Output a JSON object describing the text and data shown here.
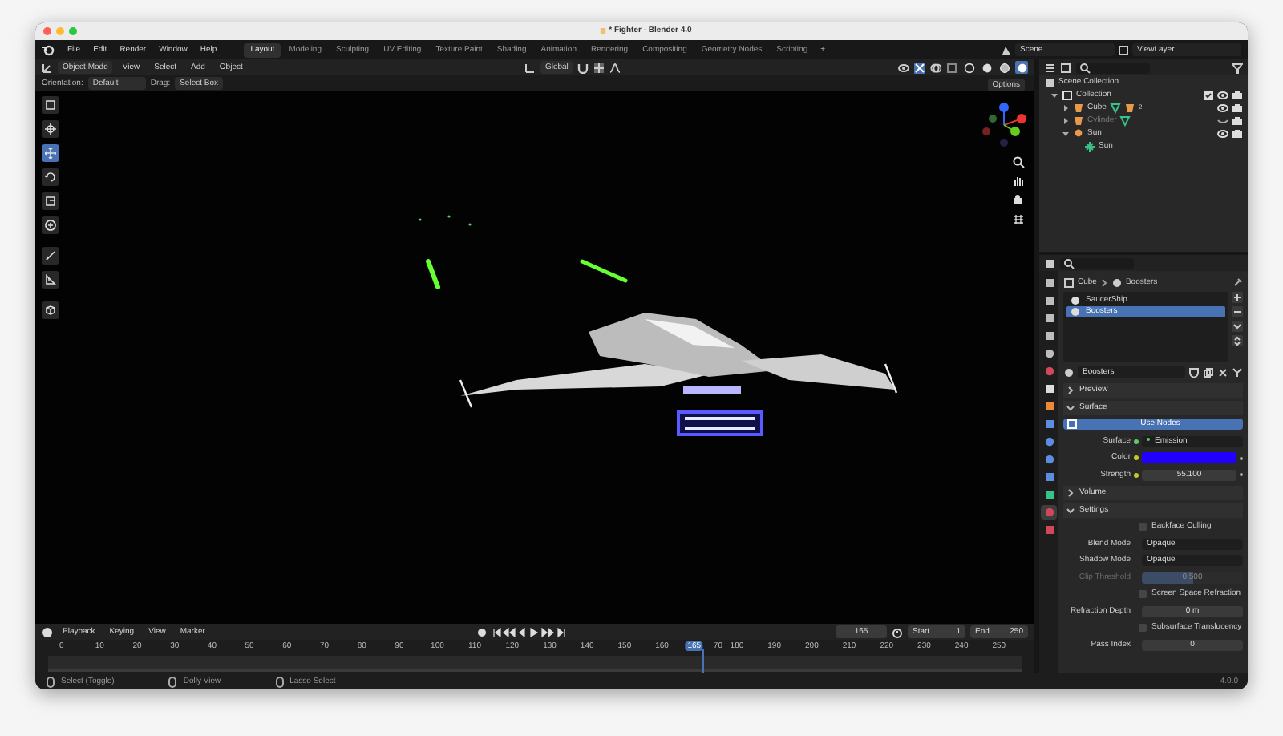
{
  "window": {
    "title": "* Fighter - Blender 4.0"
  },
  "menu": [
    "File",
    "Edit",
    "Render",
    "Window",
    "Help"
  ],
  "workspaces": [
    {
      "label": "Layout",
      "selected": true
    },
    {
      "label": "Modeling",
      "selected": false
    },
    {
      "label": "Sculpting",
      "selected": false
    },
    {
      "label": "UV Editing",
      "selected": false
    },
    {
      "label": "Texture Paint",
      "selected": false
    },
    {
      "label": "Shading",
      "selected": false
    },
    {
      "label": "Animation",
      "selected": false
    },
    {
      "label": "Rendering",
      "selected": false
    },
    {
      "label": "Compositing",
      "selected": false
    },
    {
      "label": "Geometry Nodes",
      "selected": false
    },
    {
      "label": "Scripting",
      "selected": false
    }
  ],
  "add_workspace": "+",
  "scene": "Scene",
  "view_layer": "ViewLayer",
  "viewport": {
    "mode": "Object Mode",
    "menus": [
      "View",
      "Select",
      "Add",
      "Object"
    ],
    "transform": "Global",
    "orientation_label": "Orientation:",
    "orientation": "Default",
    "drag_label": "Drag:",
    "drag": "Select Box",
    "options": "Options",
    "tools": [
      {
        "kind": "select",
        "selected": false
      },
      {
        "kind": "cursor",
        "selected": false
      },
      {
        "kind": "move",
        "selected": true
      },
      {
        "kind": "rotate",
        "selected": false
      },
      {
        "kind": "scale",
        "selected": false
      },
      {
        "kind": "transform",
        "selected": false
      },
      {
        "kind": "annotate",
        "selected": false
      },
      {
        "kind": "measure",
        "selected": false
      },
      {
        "kind": "add-cube",
        "selected": false
      }
    ],
    "shading": [
      {
        "kind": "wireframe",
        "selected": false
      },
      {
        "kind": "solid",
        "selected": false
      },
      {
        "kind": "material",
        "selected": false
      },
      {
        "kind": "rendered",
        "selected": true
      }
    ]
  },
  "outliner": {
    "root": "Scene Collection",
    "items": [
      {
        "name": "Collection",
        "kind": "collection",
        "expanded": true,
        "checked": true,
        "visible": true,
        "children": [
          {
            "name": "Cube",
            "kind": "mesh",
            "expanded": false,
            "visible": true,
            "count": "2"
          },
          {
            "name": "Cylinder",
            "kind": "mesh",
            "expanded": false,
            "visible": false
          },
          {
            "name": "Sun",
            "kind": "light",
            "expanded": true,
            "visible": true,
            "children": [
              {
                "name": "Sun",
                "kind": "light-data"
              }
            ]
          }
        ]
      }
    ]
  },
  "properties": {
    "tabs": [
      {
        "kind": "tool",
        "selected": false
      },
      {
        "kind": "render",
        "selected": false
      },
      {
        "kind": "output",
        "selected": false
      },
      {
        "kind": "view-layer",
        "selected": false
      },
      {
        "kind": "scene",
        "selected": false
      },
      {
        "kind": "world",
        "selected": false
      },
      {
        "kind": "collection",
        "selected": false
      },
      {
        "kind": "object",
        "selected": false
      },
      {
        "kind": "modifiers",
        "selected": false
      },
      {
        "kind": "particles",
        "selected": false
      },
      {
        "kind": "physics",
        "selected": false
      },
      {
        "kind": "constraints",
        "selected": false
      },
      {
        "kind": "data",
        "selected": false
      },
      {
        "kind": "material",
        "selected": true
      },
      {
        "kind": "texture",
        "selected": false
      }
    ],
    "breadcrumb": [
      "Cube",
      "Boosters"
    ],
    "slots": [
      {
        "name": "SaucerShip",
        "selected": false
      },
      {
        "name": "Boosters",
        "selected": true
      }
    ],
    "material": "Boosters",
    "panels": [
      {
        "title": "Preview",
        "expanded": false
      },
      {
        "title": "Surface",
        "expanded": true,
        "rows": [
          {
            "kind": "button",
            "label": "Use Nodes"
          },
          {
            "kind": "socket",
            "label": "Surface",
            "value": "Emission"
          },
          {
            "kind": "color",
            "label": "Color",
            "color": "#2200ff"
          },
          {
            "kind": "number",
            "label": "Strength",
            "value": "55.100",
            "socket": true
          }
        ]
      },
      {
        "title": "Volume",
        "expanded": false
      },
      {
        "title": "Settings",
        "expanded": true,
        "rows": [
          {
            "kind": "checkbox",
            "label": "Backface Culling",
            "checked": false
          },
          {
            "kind": "select",
            "label": "Blend Mode",
            "value": "Opaque"
          },
          {
            "kind": "select",
            "label": "Shadow Mode",
            "value": "Opaque"
          },
          {
            "kind": "slider",
            "label": "Clip Threshold",
            "value": "0.500",
            "level": 0.5,
            "disabled": true
          },
          {
            "kind": "checkbox",
            "label": "Screen Space Refraction",
            "checked": false
          },
          {
            "kind": "number",
            "label": "Refraction Depth",
            "value": "0 m"
          },
          {
            "kind": "checkbox",
            "label": "Subsurface Translucency",
            "checked": false
          },
          {
            "kind": "number",
            "label": "Pass Index",
            "value": "0"
          }
        ]
      }
    ]
  },
  "timeline": {
    "menus": [
      "Playback",
      "Keying",
      "View",
      "Marker"
    ],
    "current_frame": "165",
    "start_label": "Start",
    "start": "1",
    "end_label": "End",
    "end": "250",
    "ruler": [
      "0",
      "10",
      "20",
      "30",
      "40",
      "50",
      "60",
      "70",
      "80",
      "90",
      "100",
      "110",
      "120",
      "130",
      "140",
      "150",
      "160",
      "70",
      "180",
      "190",
      "200",
      "210",
      "220",
      "230",
      "240",
      "250"
    ],
    "playhead": "165",
    "level": 0.655
  },
  "status_bar": {
    "items": [
      "Select (Toggle)",
      "Dolly View",
      "Lasso Select"
    ],
    "version": "4.0.0"
  }
}
